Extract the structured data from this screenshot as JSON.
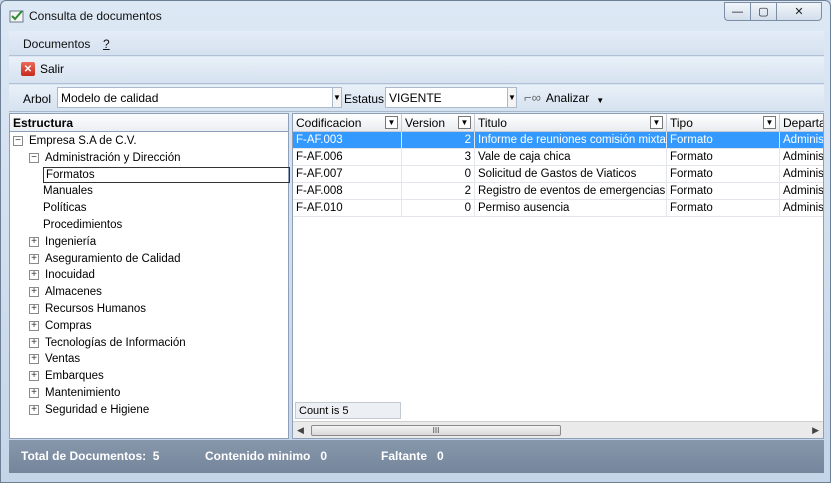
{
  "window": {
    "title": "Consulta de documentos",
    "controls": {
      "minimize": "—",
      "maximize": "▢",
      "close": "✕"
    }
  },
  "menubar": {
    "documentos": "Documentos",
    "help": "?"
  },
  "toolbar": {
    "exit_label": "Salir",
    "exit_icon": "close-x-icon"
  },
  "filters": {
    "arbol_label": "Arbol",
    "arbol_value": "Modelo de calidad",
    "estatus_label": "Estatus",
    "estatus_value": "VIGENTE",
    "analizar_label": "Analizar"
  },
  "tree": {
    "header": "Estructura",
    "nodes": [
      {
        "label": "Empresa S.A de C.V.",
        "exp": "−"
      },
      {
        "label": "Administración y Dirección",
        "exp": "−"
      },
      {
        "label": "Formatos",
        "exp": ""
      },
      {
        "label": "Manuales",
        "exp": ""
      },
      {
        "label": "Políticas",
        "exp": ""
      },
      {
        "label": "Procedimientos",
        "exp": ""
      },
      {
        "label": "Ingeniería",
        "exp": "+"
      },
      {
        "label": "Aseguramiento de Calidad",
        "exp": "+"
      },
      {
        "label": "Inocuidad",
        "exp": "+"
      },
      {
        "label": "Almacenes",
        "exp": "+"
      },
      {
        "label": "Recursos Humanos",
        "exp": "+"
      },
      {
        "label": "Compras",
        "exp": "+"
      },
      {
        "label": "Tecnologías de Información",
        "exp": "+"
      },
      {
        "label": "Ventas",
        "exp": "+"
      },
      {
        "label": "Embarques",
        "exp": "+"
      },
      {
        "label": "Mantenimiento",
        "exp": "+"
      },
      {
        "label": "Seguridad e Higiene",
        "exp": "+"
      }
    ]
  },
  "grid": {
    "columns": [
      "Codificacion",
      "Version",
      "Titulo",
      "Tipo",
      "Departam"
    ],
    "rows": [
      [
        "F-AF.003",
        "2",
        "Informe de reuniones comisión mixta de",
        "Formato",
        "Administ"
      ],
      [
        "F-AF.006",
        "3",
        "Vale de caja chica",
        "Formato",
        "Administ"
      ],
      [
        "F-AF.007",
        "0",
        "Solicitud de Gastos de Viaticos",
        "Formato",
        "Administ"
      ],
      [
        "F-AF.008",
        "2",
        "Registro de eventos de emergencias",
        "Formato",
        "Administ"
      ],
      [
        "F-AF.010",
        "0",
        "Permiso ausencia",
        "Formato",
        "Administ"
      ]
    ],
    "count_text": "Count is 5",
    "scroll_grip": "III"
  },
  "status": {
    "total_label": "Total de Documentos:",
    "total_value": "5",
    "contenido_label": "Contenido minimo",
    "contenido_value": "0",
    "faltante_label": "Faltante",
    "faltante_value": "0"
  },
  "colors": {
    "selection": "#3399ff",
    "statusbar": "#7e8fa4"
  }
}
